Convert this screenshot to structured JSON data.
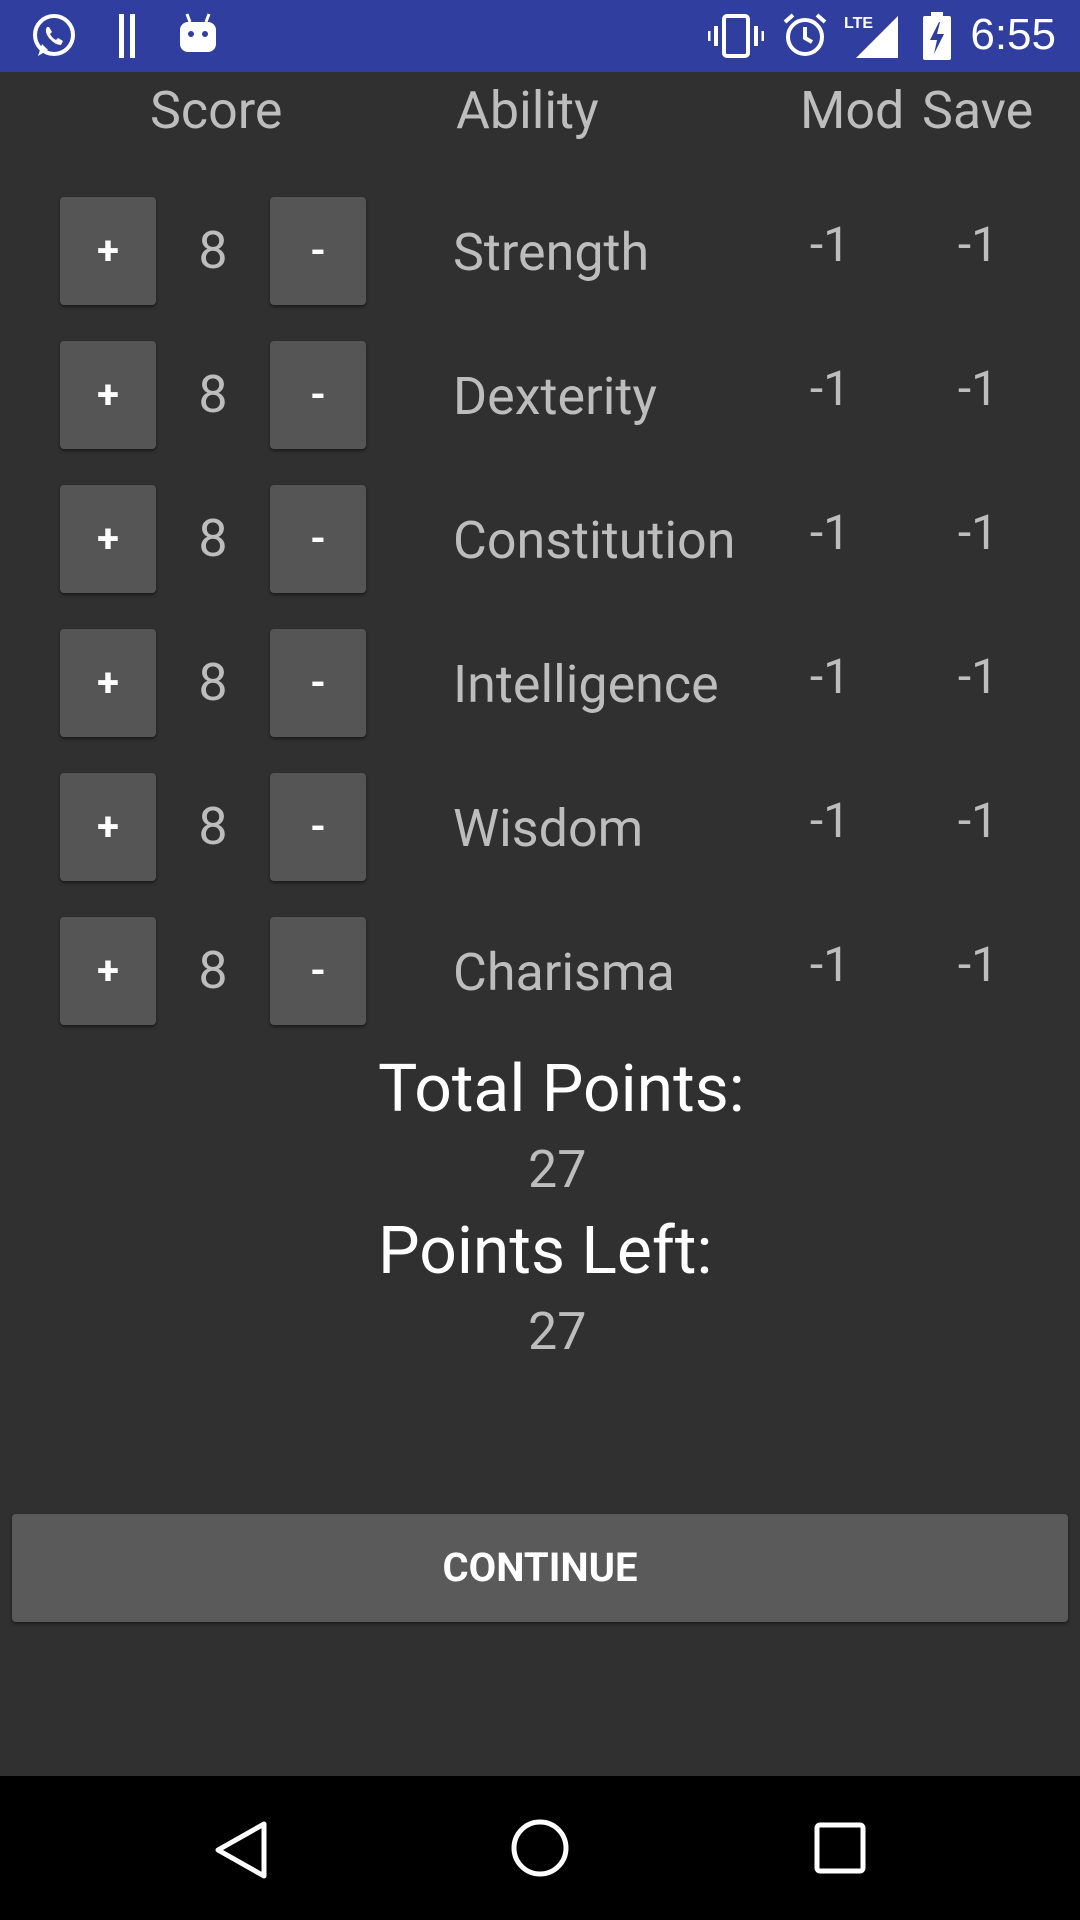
{
  "status_bar": {
    "time": "6:55",
    "network_label": "LTE",
    "left_icons": [
      "whatsapp-icon",
      "pause-icon",
      "android-icon"
    ],
    "right_icons": [
      "vibrate-icon",
      "alarm-icon",
      "lte-signal-icon",
      "battery-charging-icon"
    ]
  },
  "headers": {
    "score": "Score",
    "ability": "Ability",
    "mod": "Mod",
    "save": "Save"
  },
  "abilities": [
    {
      "name": "Strength",
      "score": "8",
      "mod": "-1",
      "save": "-1",
      "plus": "+",
      "minus": "-"
    },
    {
      "name": "Dexterity",
      "score": "8",
      "mod": "-1",
      "save": "-1",
      "plus": "+",
      "minus": "-"
    },
    {
      "name": "Constitution",
      "score": "8",
      "mod": "-1",
      "save": "-1",
      "plus": "+",
      "minus": "-"
    },
    {
      "name": "Intelligence",
      "score": "8",
      "mod": "-1",
      "save": "-1",
      "plus": "+",
      "minus": "-"
    },
    {
      "name": "Wisdom",
      "score": "8",
      "mod": "-1",
      "save": "-1",
      "plus": "+",
      "minus": "-"
    },
    {
      "name": "Charisma",
      "score": "8",
      "mod": "-1",
      "save": "-1",
      "plus": "+",
      "minus": "-"
    }
  ],
  "summary": {
    "total_label": "Total Points:",
    "total_value": "27",
    "left_label": "Points Left:",
    "left_value": "27"
  },
  "continue_label": "CONTINUE",
  "nav_bar": [
    "back-icon",
    "home-icon",
    "recents-icon"
  ],
  "colors": {
    "status_bar": "#303f9f",
    "background": "#303030",
    "button": "#555555",
    "nav_bar": "#000000"
  }
}
